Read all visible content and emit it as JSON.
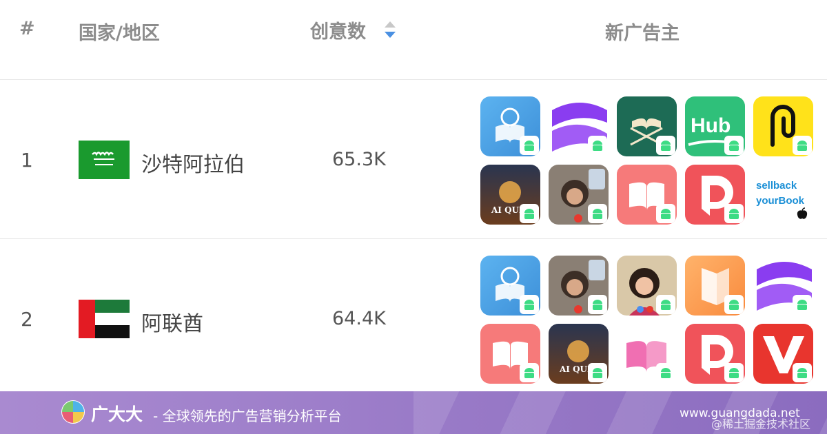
{
  "header": {
    "num": "#",
    "country": "国家/地区",
    "count": "创意数",
    "advertisers": "新广告主"
  },
  "rows": [
    {
      "rank": "1",
      "country": "沙特阿拉伯",
      "count": "65.3K",
      "flag": "saudi-arabia-flag",
      "apps": [
        {
          "icon": "book-app-icon",
          "platform": "android"
        },
        {
          "icon": "purple-wave-app-icon",
          "platform": "android"
        },
        {
          "icon": "quran-stand-app-icon",
          "platform": "android"
        },
        {
          "icon": "hub-app-icon",
          "label": "Hub",
          "platform": "android"
        },
        {
          "icon": "yellow-r-app-icon",
          "platform": "android"
        },
        {
          "icon": "al-quran-app-icon",
          "label": "AI QURA",
          "platform": "android"
        },
        {
          "icon": "video-call-app-icon",
          "platform": "android"
        },
        {
          "icon": "open-book-app-icon",
          "platform": "android"
        },
        {
          "icon": "red-d-app-icon",
          "platform": "android"
        },
        {
          "icon": "sellback-app-icon",
          "label": "sellback yourBook",
          "platform": "ios"
        }
      ]
    },
    {
      "rank": "2",
      "country": "阿联酋",
      "count": "64.4K",
      "flag": "uae-flag",
      "apps": [
        {
          "icon": "book-app-icon",
          "platform": "android"
        },
        {
          "icon": "video-call-app-icon",
          "platform": "android"
        },
        {
          "icon": "video-call-woman-app-icon",
          "platform": "android"
        },
        {
          "icon": "orange-book-app-icon",
          "platform": "android"
        },
        {
          "icon": "purple-wave-app-icon",
          "platform": "android"
        },
        {
          "icon": "open-book-app-icon",
          "platform": "android"
        },
        {
          "icon": "al-quran-app-icon",
          "label": "AI QURA",
          "platform": "android"
        },
        {
          "icon": "pink-book-app-icon",
          "platform": "android"
        },
        {
          "icon": "red-d-app-icon",
          "platform": "android"
        },
        {
          "icon": "red-v-app-icon",
          "platform": "android"
        }
      ]
    }
  ],
  "footer": {
    "brand": "广大大",
    "slogan": "- 全球领先的广告营销分析平台",
    "site": "www.guangdada.net",
    "watermark": "@稀土掘金技术社区"
  },
  "colors": {
    "sort_active": "#4a90e2",
    "footer_purple": "#9a7bc8",
    "android_green": "#3ddc84"
  }
}
